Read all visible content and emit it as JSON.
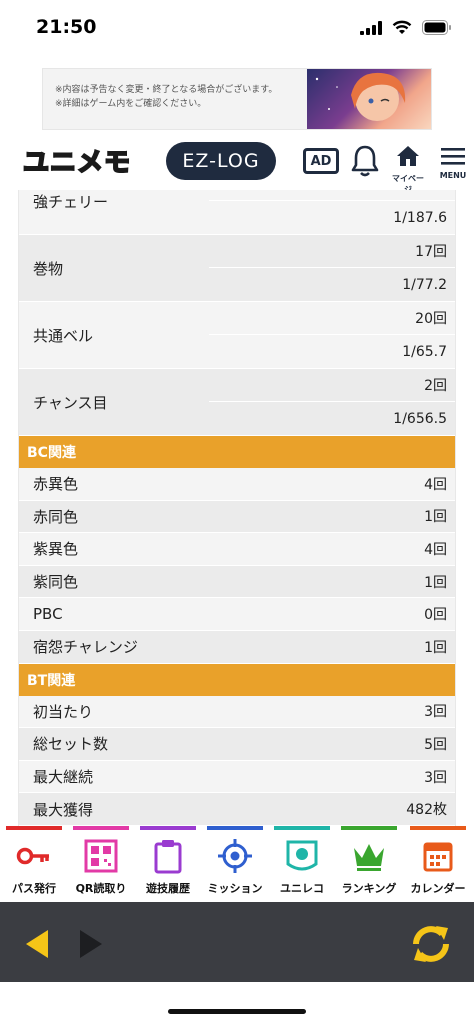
{
  "status_bar": {
    "time": "21:50"
  },
  "ad_banner": {
    "line1": "※内容は予告なく変更・終了となる場合がございます。",
    "line2": "※詳細はゲーム内をご確認ください。"
  },
  "header": {
    "logo_text": "ユニメモ",
    "ezlog_label": "EZ-LOG",
    "ad_label": "AD",
    "mypage_label": "マイページ",
    "menu_label": "MENU"
  },
  "top_rows": [
    {
      "label": "強チェリー",
      "count": "",
      "rate": "1/187.6"
    },
    {
      "label": "巻物",
      "count": "17回",
      "rate": "1/77.2"
    },
    {
      "label": "共通ベル",
      "count": "20回",
      "rate": "1/65.7"
    },
    {
      "label": "チャンス目",
      "count": "2回",
      "rate": "1/656.5"
    }
  ],
  "bc_section": {
    "title": "BC関連",
    "rows": [
      {
        "label": "赤異色",
        "value": "4回"
      },
      {
        "label": "赤同色",
        "value": "1回"
      },
      {
        "label": "紫異色",
        "value": "4回"
      },
      {
        "label": "紫同色",
        "value": "1回"
      },
      {
        "label": "PBC",
        "value": "0回"
      },
      {
        "label": "宿怨チャレンジ",
        "value": "1回"
      }
    ]
  },
  "bt_section": {
    "title": "BT関連",
    "rows": [
      {
        "label": "初当たり",
        "value": "3回"
      },
      {
        "label": "総セット数",
        "value": "5回"
      },
      {
        "label": "最大継続",
        "value": "3回"
      },
      {
        "label": "最大獲得",
        "value": "482枚"
      }
    ]
  },
  "bottom_nav": [
    {
      "label": "パス発行",
      "icon": "key-icon",
      "color": "#e02a2a"
    },
    {
      "label": "QR読取り",
      "icon": "qr-code-icon",
      "color": "#e23aa6"
    },
    {
      "label": "遊技履歴",
      "icon": "clipboard-icon",
      "color": "#9a3bd0"
    },
    {
      "label": "ミッション",
      "icon": "target-icon",
      "color": "#2f5fcf"
    },
    {
      "label": "ユニレコ",
      "icon": "unireco-badge-icon",
      "color": "#1fb5a8"
    },
    {
      "label": "ランキング",
      "icon": "crown-icon",
      "color": "#3aa62f"
    },
    {
      "label": "カレンダー",
      "icon": "calendar-icon",
      "color": "#e85a1a"
    }
  ],
  "colors": {
    "section_header": "#e9a12a",
    "browser_bar": "#3b3d42",
    "accent_yellow": "#f5c518"
  }
}
